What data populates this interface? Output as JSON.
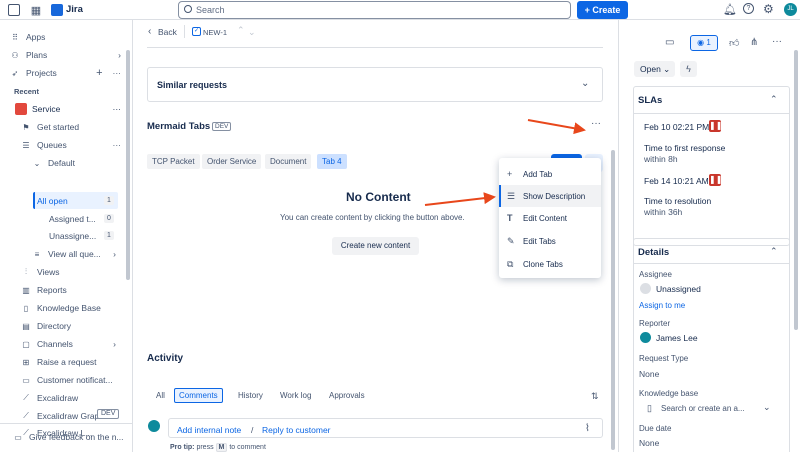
{
  "topbar": {
    "app_name": "Jira",
    "search_placeholder": "Search",
    "create_label": "+ Create",
    "avatar_initials": "JL"
  },
  "sidebar": {
    "apps": "Apps",
    "plans": "Plans",
    "projects": "Projects",
    "recent": "Recent",
    "service": "Service",
    "get_started": "Get started",
    "queues": "Queues",
    "default": "Default",
    "all_open": "All open",
    "all_open_count": "1",
    "assigned": "Assigned t...",
    "assigned_count": "0",
    "unassigned": "Unassigne...",
    "unassigned_count": "1",
    "view_all": "View all que...",
    "views": "Views",
    "reports": "Reports",
    "kb": "Knowledge Base",
    "directory": "Directory",
    "channels": "Channels",
    "raise": "Raise a request",
    "customer_notif": "Customer notificat...",
    "excalidraw": "Excalidraw",
    "excalidraw_graph": "Excalidraw Graph...",
    "excalidraw_l": "Excalidraw L...",
    "dev_badge": "DEV",
    "feedback": "Give feedback on the n..."
  },
  "main": {
    "back": "Back",
    "issue_key": "NEW-1",
    "similar_requests": "Similar requests",
    "app_title": "Mermaid Tabs",
    "app_badge": "DEV",
    "tabs": [
      "TCP Packet",
      "Order Service",
      "Document",
      "Tab 4"
    ],
    "save": "Save",
    "no_content": "No Content",
    "no_content_desc": "You can create content by clicking the button above.",
    "create_new": "Create new content",
    "menu": [
      "Add Tab",
      "Show Description",
      "Edit Content",
      "Edit Tabs",
      "Clone Tabs"
    ],
    "activity": "Activity",
    "activity_tabs": [
      "All",
      "Comments",
      "History",
      "Work log",
      "Approvals"
    ],
    "add_internal_note": "Add internal note",
    "separator": "/",
    "reply_customer": "Reply to customer",
    "pro_tip_prefix": "Pro tip:",
    "pro_tip_press": "press",
    "pro_tip_key": "M",
    "pro_tip_suffix": "to comment"
  },
  "right": {
    "watch_count": "1",
    "status": "Open",
    "slas_title": "SLAs",
    "sla1_date": "Feb 10 02:21 PM",
    "sla1_label": "Time to first response",
    "sla1_within": "within 8h",
    "sla2_date": "Feb 14 10:21 AM",
    "sla2_label": "Time to resolution",
    "sla2_within": "within 36h",
    "details_title": "Details",
    "assignee_label": "Assignee",
    "assignee_value": "Unassigned",
    "assign_to_me": "Assign to me",
    "reporter_label": "Reporter",
    "reporter_value": "James Lee",
    "request_type_label": "Request Type",
    "request_type_value": "None",
    "kb_label": "Knowledge base",
    "kb_placeholder": "Search or create an a...",
    "due_date_label": "Due date",
    "due_date_value": "None"
  },
  "colors": {
    "brand": "#0c66e4",
    "sla_pause": "#c9372c",
    "arrow": "#e8471b"
  }
}
